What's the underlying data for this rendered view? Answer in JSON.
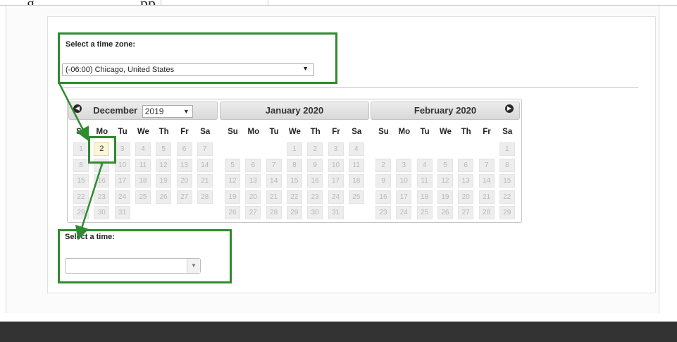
{
  "caption": "g",
  "caption_fragment": "pp",
  "timezone": {
    "label": "Select a time zone:",
    "selected": "(-06:00) Chicago, United States"
  },
  "calendar": {
    "weekdays": [
      "Su",
      "Mo",
      "Tu",
      "We",
      "Th",
      "Fr",
      "Sa"
    ],
    "months": [
      {
        "title": "December",
        "year_selected": "2019",
        "weeks": [
          [
            "1",
            "2",
            "3",
            "4",
            "5",
            "6",
            "7"
          ],
          [
            "8",
            "9",
            "10",
            "11",
            "12",
            "13",
            "14"
          ],
          [
            "15",
            "16",
            "17",
            "18",
            "19",
            "20",
            "21"
          ],
          [
            "22",
            "23",
            "24",
            "25",
            "26",
            "27",
            "28"
          ],
          [
            "29",
            "30",
            "31",
            "",
            "",
            "",
            ""
          ]
        ]
      },
      {
        "title": "January 2020",
        "weeks": [
          [
            "",
            "",
            "",
            "1",
            "2",
            "3",
            "4"
          ],
          [
            "5",
            "6",
            "7",
            "8",
            "9",
            "10",
            "11"
          ],
          [
            "12",
            "13",
            "14",
            "15",
            "16",
            "17",
            "18"
          ],
          [
            "19",
            "20",
            "21",
            "22",
            "23",
            "24",
            "25"
          ],
          [
            "26",
            "27",
            "28",
            "29",
            "30",
            "31",
            ""
          ]
        ]
      },
      {
        "title": "February 2020",
        "weeks": [
          [
            "",
            "",
            "",
            "",
            "",
            "",
            "1"
          ],
          [
            "2",
            "3",
            "4",
            "5",
            "6",
            "7",
            "8"
          ],
          [
            "9",
            "10",
            "11",
            "12",
            "13",
            "14",
            "15"
          ],
          [
            "16",
            "17",
            "18",
            "19",
            "20",
            "21",
            "22"
          ],
          [
            "23",
            "24",
            "25",
            "26",
            "27",
            "28",
            "29"
          ]
        ]
      }
    ],
    "selected_day": "2",
    "prev_icon": "circle-left-arrow-icon",
    "next_icon": "circle-right-arrow-icon"
  },
  "time": {
    "label": "Select a time:",
    "value": ""
  },
  "colors": {
    "highlight": "#2e8b2e",
    "footer": "#333333",
    "today_bg": "#fcf6d8"
  }
}
